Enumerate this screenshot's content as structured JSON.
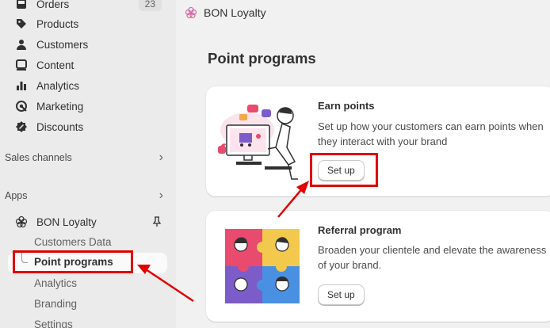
{
  "sidebar": {
    "items": [
      {
        "label": "Orders",
        "badge": "23",
        "icon": "orders-icon"
      },
      {
        "label": "Products",
        "icon": "tag-icon"
      },
      {
        "label": "Customers",
        "icon": "person-icon"
      },
      {
        "label": "Content",
        "icon": "content-icon"
      },
      {
        "label": "Analytics",
        "icon": "bar-chart-icon"
      },
      {
        "label": "Marketing",
        "icon": "target-icon"
      },
      {
        "label": "Discounts",
        "icon": "discount-icon"
      }
    ],
    "sales_channels": "Sales channels",
    "apps": "Apps",
    "app_name": "BON Loyalty",
    "sub_items": [
      "Customers Data",
      "Point programs",
      "Analytics",
      "Branding",
      "Settings"
    ]
  },
  "header": {
    "app_title": "BON Loyalty"
  },
  "main": {
    "page_title": "Point programs",
    "cards": [
      {
        "title": "Earn points",
        "description": "Set up how your customers can earn points when they interact with your brand",
        "button": "Set up"
      },
      {
        "title": "Referral program",
        "description": "Broaden your clientele and elevate the awareness of your brand.",
        "button": "Set up"
      }
    ]
  },
  "colors": {
    "annotation": "#e00000",
    "sidebar_bg": "#ebebeb",
    "page_bg": "#f1f1f1"
  }
}
